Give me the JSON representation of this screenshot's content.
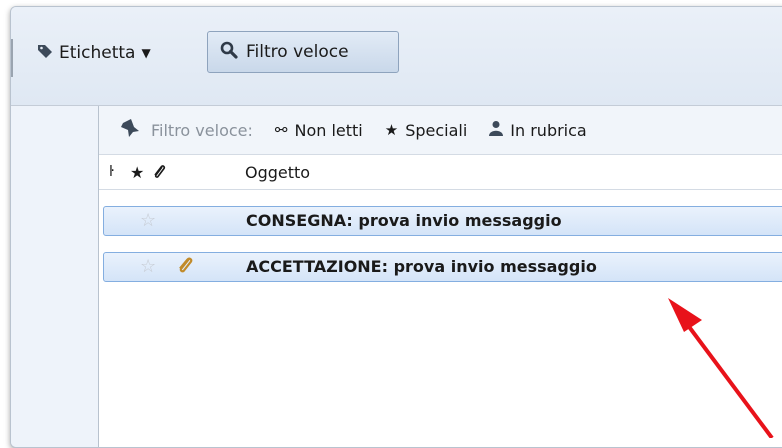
{
  "toolbar": {
    "tag_label": "Etichetta",
    "quick_filter_label": "Filtro veloce"
  },
  "quick_filter_bar": {
    "label": "Filtro veloce:",
    "unread": "Non letti",
    "starred": "Speciali",
    "contacts": "In rubrica"
  },
  "columns": {
    "thread_icon": "ŀ",
    "star_icon": "★",
    "attachment_icon": "✎",
    "subject": "Oggetto"
  },
  "messages": [
    {
      "subject": "CONSEGNA: prova invio messaggio",
      "starred": false,
      "has_attachment": false
    },
    {
      "subject": "ACCETTAZIONE: prova invio messaggio",
      "starred": false,
      "has_attachment": true
    }
  ],
  "colors": {
    "selection": "#d4e4f8",
    "selection_border": "#84aee0",
    "arrow": "#e8121a",
    "attachment": "#c18b2a"
  }
}
